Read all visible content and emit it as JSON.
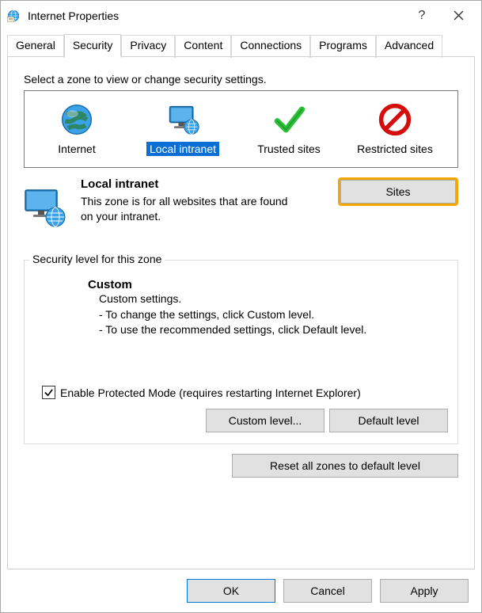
{
  "window": {
    "title": "Internet Properties",
    "help_icon": "?",
    "close_icon": "✕"
  },
  "tabs": {
    "items": [
      {
        "label": "General"
      },
      {
        "label": "Security"
      },
      {
        "label": "Privacy"
      },
      {
        "label": "Content"
      },
      {
        "label": "Connections"
      },
      {
        "label": "Programs"
      },
      {
        "label": "Advanced"
      }
    ],
    "active_index": 1
  },
  "security": {
    "instruction": "Select a zone to view or change security settings.",
    "zones": [
      {
        "label": "Internet"
      },
      {
        "label": "Local intranet"
      },
      {
        "label": "Trusted sites"
      },
      {
        "label": "Restricted sites"
      }
    ],
    "selected_index": 1,
    "info": {
      "heading": "Local intranet",
      "description": "This zone is for all websites that are found on your intranet."
    },
    "sites_button": "Sites",
    "fieldset": {
      "legend": "Security level for this zone",
      "custom": {
        "title": "Custom",
        "line1": "Custom settings.",
        "line2": "- To change the settings, click Custom level.",
        "line3": "- To use the recommended settings, click Default level."
      },
      "checkbox_label": "Enable Protected Mode (requires restarting Internet Explorer)",
      "checkbox_checked": true,
      "custom_level_button": "Custom level...",
      "default_level_button": "Default level"
    },
    "reset_button": "Reset all zones to default level"
  },
  "dialog_buttons": {
    "ok": "OK",
    "cancel": "Cancel",
    "apply": "Apply"
  }
}
